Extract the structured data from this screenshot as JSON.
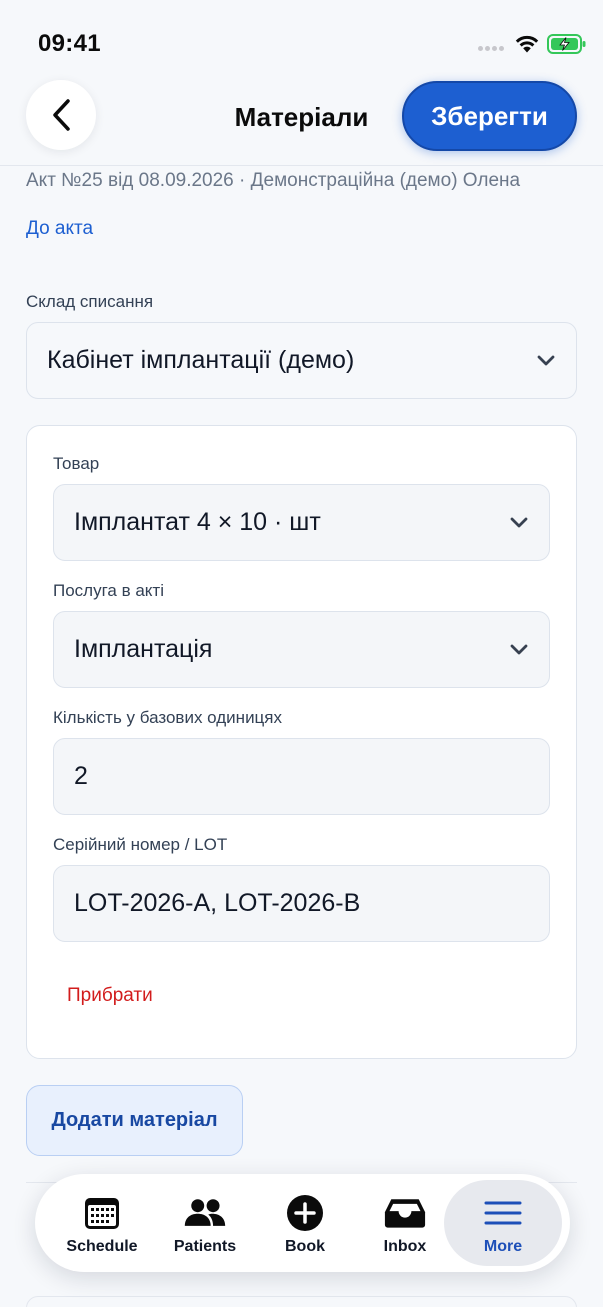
{
  "status_bar": {
    "time": "09:41"
  },
  "header": {
    "title": "Матеріали",
    "save_label": "Зберегти"
  },
  "act": {
    "subtitle": "Акт №25 від 08.09.2026 · Демонстраційна (демо) Олена",
    "back_link": "До акта"
  },
  "warehouse": {
    "label": "Склад списання",
    "value": "Кабінет імплантації (демо)"
  },
  "material": {
    "product_label": "Товар",
    "product_value": "Імплантат 4 × 10 · шт",
    "service_label": "Послуга в акті",
    "service_value": "Імплантація",
    "quantity_label": "Кількість у базових одиницях",
    "quantity_value": "2",
    "serial_label": "Серійний номер / LOT",
    "serial_value": "LOT-2026-A, LOT-2026-B",
    "remove_label": "Прибрати"
  },
  "add_material_label": "Додати матеріал",
  "tab_bar": {
    "items": [
      {
        "label": "Schedule",
        "icon": "calendar-icon"
      },
      {
        "label": "Patients",
        "icon": "people-icon"
      },
      {
        "label": "Book",
        "icon": "plus-circle-icon"
      },
      {
        "label": "Inbox",
        "icon": "inbox-icon"
      },
      {
        "label": "More",
        "icon": "menu-icon",
        "active": true
      }
    ]
  },
  "colors": {
    "accent": "#1d5fd1",
    "danger": "#d21c1c",
    "battery": "#34c759"
  }
}
